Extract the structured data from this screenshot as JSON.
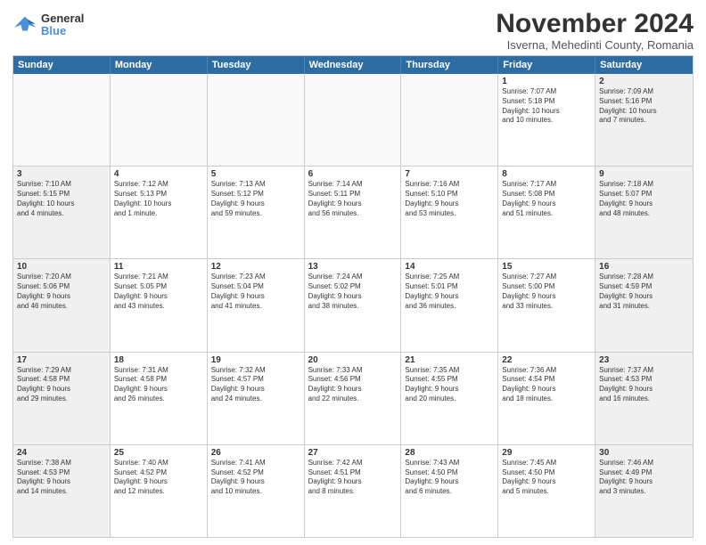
{
  "header": {
    "logo": {
      "line1": "General",
      "line2": "Blue"
    },
    "title": "November 2024",
    "subtitle": "Isverna, Mehedinti County, Romania"
  },
  "calendar": {
    "days_of_week": [
      "Sunday",
      "Monday",
      "Tuesday",
      "Wednesday",
      "Thursday",
      "Friday",
      "Saturday"
    ],
    "rows": [
      [
        {
          "day": "",
          "info": "",
          "empty": true
        },
        {
          "day": "",
          "info": "",
          "empty": true
        },
        {
          "day": "",
          "info": "",
          "empty": true
        },
        {
          "day": "",
          "info": "",
          "empty": true
        },
        {
          "day": "",
          "info": "",
          "empty": true
        },
        {
          "day": "1",
          "info": "Sunrise: 7:07 AM\nSunset: 5:18 PM\nDaylight: 10 hours\nand 10 minutes.",
          "empty": false
        },
        {
          "day": "2",
          "info": "Sunrise: 7:09 AM\nSunset: 5:16 PM\nDaylight: 10 hours\nand 7 minutes.",
          "empty": false
        }
      ],
      [
        {
          "day": "3",
          "info": "Sunrise: 7:10 AM\nSunset: 5:15 PM\nDaylight: 10 hours\nand 4 minutes.",
          "empty": false
        },
        {
          "day": "4",
          "info": "Sunrise: 7:12 AM\nSunset: 5:13 PM\nDaylight: 10 hours\nand 1 minute.",
          "empty": false
        },
        {
          "day": "5",
          "info": "Sunrise: 7:13 AM\nSunset: 5:12 PM\nDaylight: 9 hours\nand 59 minutes.",
          "empty": false
        },
        {
          "day": "6",
          "info": "Sunrise: 7:14 AM\nSunset: 5:11 PM\nDaylight: 9 hours\nand 56 minutes.",
          "empty": false
        },
        {
          "day": "7",
          "info": "Sunrise: 7:16 AM\nSunset: 5:10 PM\nDaylight: 9 hours\nand 53 minutes.",
          "empty": false
        },
        {
          "day": "8",
          "info": "Sunrise: 7:17 AM\nSunset: 5:08 PM\nDaylight: 9 hours\nand 51 minutes.",
          "empty": false
        },
        {
          "day": "9",
          "info": "Sunrise: 7:18 AM\nSunset: 5:07 PM\nDaylight: 9 hours\nand 48 minutes.",
          "empty": false
        }
      ],
      [
        {
          "day": "10",
          "info": "Sunrise: 7:20 AM\nSunset: 5:06 PM\nDaylight: 9 hours\nand 46 minutes.",
          "empty": false
        },
        {
          "day": "11",
          "info": "Sunrise: 7:21 AM\nSunset: 5:05 PM\nDaylight: 9 hours\nand 43 minutes.",
          "empty": false
        },
        {
          "day": "12",
          "info": "Sunrise: 7:23 AM\nSunset: 5:04 PM\nDaylight: 9 hours\nand 41 minutes.",
          "empty": false
        },
        {
          "day": "13",
          "info": "Sunrise: 7:24 AM\nSunset: 5:02 PM\nDaylight: 9 hours\nand 38 minutes.",
          "empty": false
        },
        {
          "day": "14",
          "info": "Sunrise: 7:25 AM\nSunset: 5:01 PM\nDaylight: 9 hours\nand 36 minutes.",
          "empty": false
        },
        {
          "day": "15",
          "info": "Sunrise: 7:27 AM\nSunset: 5:00 PM\nDaylight: 9 hours\nand 33 minutes.",
          "empty": false
        },
        {
          "day": "16",
          "info": "Sunrise: 7:28 AM\nSunset: 4:59 PM\nDaylight: 9 hours\nand 31 minutes.",
          "empty": false
        }
      ],
      [
        {
          "day": "17",
          "info": "Sunrise: 7:29 AM\nSunset: 4:58 PM\nDaylight: 9 hours\nand 29 minutes.",
          "empty": false
        },
        {
          "day": "18",
          "info": "Sunrise: 7:31 AM\nSunset: 4:58 PM\nDaylight: 9 hours\nand 26 minutes.",
          "empty": false
        },
        {
          "day": "19",
          "info": "Sunrise: 7:32 AM\nSunset: 4:57 PM\nDaylight: 9 hours\nand 24 minutes.",
          "empty": false
        },
        {
          "day": "20",
          "info": "Sunrise: 7:33 AM\nSunset: 4:56 PM\nDaylight: 9 hours\nand 22 minutes.",
          "empty": false
        },
        {
          "day": "21",
          "info": "Sunrise: 7:35 AM\nSunset: 4:55 PM\nDaylight: 9 hours\nand 20 minutes.",
          "empty": false
        },
        {
          "day": "22",
          "info": "Sunrise: 7:36 AM\nSunset: 4:54 PM\nDaylight: 9 hours\nand 18 minutes.",
          "empty": false
        },
        {
          "day": "23",
          "info": "Sunrise: 7:37 AM\nSunset: 4:53 PM\nDaylight: 9 hours\nand 16 minutes.",
          "empty": false
        }
      ],
      [
        {
          "day": "24",
          "info": "Sunrise: 7:38 AM\nSunset: 4:53 PM\nDaylight: 9 hours\nand 14 minutes.",
          "empty": false
        },
        {
          "day": "25",
          "info": "Sunrise: 7:40 AM\nSunset: 4:52 PM\nDaylight: 9 hours\nand 12 minutes.",
          "empty": false
        },
        {
          "day": "26",
          "info": "Sunrise: 7:41 AM\nSunset: 4:52 PM\nDaylight: 9 hours\nand 10 minutes.",
          "empty": false
        },
        {
          "day": "27",
          "info": "Sunrise: 7:42 AM\nSunset: 4:51 PM\nDaylight: 9 hours\nand 8 minutes.",
          "empty": false
        },
        {
          "day": "28",
          "info": "Sunrise: 7:43 AM\nSunset: 4:50 PM\nDaylight: 9 hours\nand 6 minutes.",
          "empty": false
        },
        {
          "day": "29",
          "info": "Sunrise: 7:45 AM\nSunset: 4:50 PM\nDaylight: 9 hours\nand 5 minutes.",
          "empty": false
        },
        {
          "day": "30",
          "info": "Sunrise: 7:46 AM\nSunset: 4:49 PM\nDaylight: 9 hours\nand 3 minutes.",
          "empty": false
        }
      ]
    ]
  }
}
